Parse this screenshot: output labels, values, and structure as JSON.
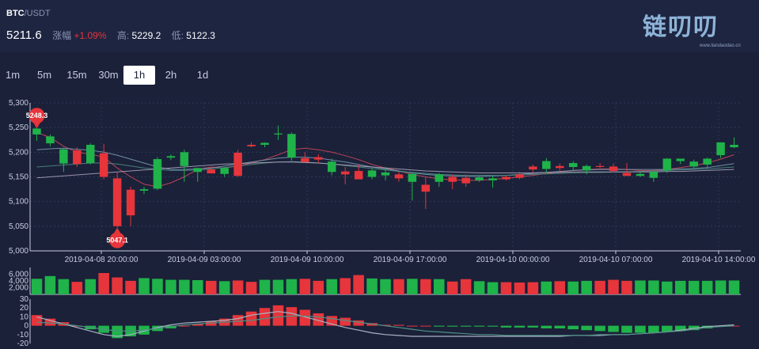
{
  "header": {
    "pair_base": "BTC",
    "pair_quote": "/USDT",
    "last_price": "5211.6",
    "change_label": "涨幅",
    "change_value": "+1.09%",
    "high_label": "高:",
    "high_value": "5229.2",
    "low_label": "低:",
    "low_value": "5122.3"
  },
  "logo": {
    "text": "链叨叨",
    "url": "www.liandaodao.cn"
  },
  "timeframes": [
    {
      "label": "1m"
    },
    {
      "label": "5m"
    },
    {
      "label": "15m"
    },
    {
      "label": "30m"
    },
    {
      "label": "1h"
    },
    {
      "label": "2h"
    },
    {
      "label": "1d"
    }
  ],
  "active_timeframe": "1h",
  "colors": {
    "up": "#1fb34a",
    "down": "#e6353b",
    "grid": "#2f3859",
    "axis": "#c8cde0",
    "background": "#1b2139"
  },
  "chart_data": [
    {
      "type": "candlestick",
      "y_ticks": [
        "5,000",
        "5,050",
        "5,100",
        "5,150",
        "5,200",
        "5,250",
        "5,300"
      ],
      "ylim": [
        5000,
        5300
      ],
      "x_ticks": [
        "2019-04-08 20:00:00",
        "2019-04-09 03:00:00",
        "2019-04-09 10:00:00",
        "2019-04-09 17:00:00",
        "2019-04-10 00:00:00",
        "2019-04-10 07:00:00",
        "2019-04-10 14:00:00"
      ],
      "max_label": "5248.3",
      "min_label": "5047.1",
      "candles": [
        [
          5236,
          5250,
          5223,
          5248
        ],
        [
          5218,
          5236,
          5212,
          5232
        ],
        [
          5177,
          5208,
          5160,
          5206
        ],
        [
          5204,
          5210,
          5170,
          5176
        ],
        [
          5178,
          5218,
          5175,
          5215
        ],
        [
          5198,
          5217,
          5145,
          5150
        ],
        [
          5147,
          5160,
          5047,
          5050
        ],
        [
          5124,
          5130,
          5050,
          5072
        ],
        [
          5122,
          5130,
          5115,
          5125
        ],
        [
          5126,
          5190,
          5123,
          5186
        ],
        [
          5189,
          5196,
          5184,
          5192
        ],
        [
          5172,
          5205,
          5140,
          5200
        ],
        [
          5160,
          5168,
          5140,
          5168
        ],
        [
          5165,
          5170,
          5158,
          5157
        ],
        [
          5156,
          5170,
          5150,
          5168
        ],
        [
          5199,
          5205,
          5150,
          5152
        ],
        [
          5215,
          5220,
          5210,
          5212
        ],
        [
          5215,
          5220,
          5210,
          5219
        ],
        [
          5236,
          5254,
          5225,
          5238
        ],
        [
          5189,
          5240,
          5183,
          5237
        ],
        [
          5188,
          5200,
          5180,
          5180
        ],
        [
          5190,
          5196,
          5178,
          5185
        ],
        [
          5160,
          5187,
          5153,
          5181
        ],
        [
          5161,
          5170,
          5135,
          5155
        ],
        [
          5162,
          5175,
          5150,
          5145
        ],
        [
          5150,
          5168,
          5145,
          5163
        ],
        [
          5153,
          5170,
          5143,
          5159
        ],
        [
          5155,
          5160,
          5140,
          5147
        ],
        [
          5140,
          5158,
          5102,
          5156
        ],
        [
          5134,
          5150,
          5085,
          5120
        ],
        [
          5140,
          5158,
          5130,
          5155
        ],
        [
          5150,
          5155,
          5125,
          5140
        ],
        [
          5148,
          5155,
          5130,
          5137
        ],
        [
          5143,
          5150,
          5140,
          5149
        ],
        [
          5143,
          5152,
          5128,
          5147
        ],
        [
          5150,
          5153,
          5143,
          5145
        ],
        [
          5155,
          5160,
          5145,
          5148
        ],
        [
          5171,
          5175,
          5158,
          5165
        ],
        [
          5166,
          5188,
          5158,
          5182
        ],
        [
          5172,
          5177,
          5160,
          5168
        ],
        [
          5170,
          5182,
          5162,
          5178
        ],
        [
          5163,
          5175,
          5155,
          5172
        ],
        [
          5172,
          5178,
          5168,
          5170
        ],
        [
          5171,
          5177,
          5159,
          5162
        ],
        [
          5158,
          5178,
          5152,
          5152
        ],
        [
          5152,
          5160,
          5150,
          5156
        ],
        [
          5148,
          5163,
          5140,
          5160
        ],
        [
          5163,
          5188,
          5158,
          5187
        ],
        [
          5182,
          5186,
          5176,
          5187
        ],
        [
          5171,
          5185,
          5167,
          5181
        ],
        [
          5175,
          5189,
          5167,
          5187
        ],
        [
          5194,
          5220,
          5188,
          5220
        ],
        [
          5210,
          5230,
          5208,
          5215
        ]
      ],
      "ma_lines": [
        {
          "color": "#d64a5a",
          "values": [
            5240,
            5230,
            5212,
            5200,
            5196,
            5190,
            5168,
            5150,
            5135,
            5130,
            5138,
            5150,
            5165,
            5170,
            5168,
            5172,
            5178,
            5185,
            5195,
            5205,
            5208,
            5205,
            5200,
            5193,
            5185,
            5175,
            5168,
            5162,
            5155,
            5150,
            5146,
            5144,
            5143,
            5143,
            5145,
            5147,
            5150,
            5153,
            5157,
            5160,
            5163,
            5165,
            5166,
            5166,
            5165,
            5163,
            5163,
            5165,
            5169,
            5173,
            5178,
            5186,
            5195
          ]
        },
        {
          "color": "#7fa0b8",
          "values": [
            5205,
            5207,
            5208,
            5206,
            5204,
            5200,
            5194,
            5186,
            5178,
            5170,
            5165,
            5165,
            5166,
            5168,
            5172,
            5176,
            5180,
            5184,
            5188,
            5190,
            5190,
            5188,
            5184,
            5180,
            5175,
            5170,
            5166,
            5162,
            5158,
            5155,
            5153,
            5152,
            5151,
            5151,
            5152,
            5153,
            5155,
            5157,
            5159,
            5161,
            5163,
            5164,
            5165,
            5165,
            5165,
            5165,
            5165,
            5165,
            5166,
            5167,
            5169,
            5173,
            5177
          ]
        },
        {
          "color": "#4f8f86",
          "values": [
            5170,
            5172,
            5174,
            5176,
            5178,
            5178,
            5176,
            5172,
            5168,
            5165,
            5163,
            5163,
            5164,
            5166,
            5169,
            5172,
            5175,
            5178,
            5180,
            5181,
            5180,
            5178,
            5176,
            5173,
            5170,
            5167,
            5164,
            5161,
            5159,
            5157,
            5155,
            5154,
            5153,
            5153,
            5153,
            5153,
            5154,
            5155,
            5156,
            5157,
            5158,
            5159,
            5159,
            5160,
            5160,
            5161,
            5162,
            5163,
            5164,
            5165,
            5166,
            5168,
            5170
          ]
        },
        {
          "color": "#b0a8c0",
          "values": [
            5148,
            5150,
            5152,
            5154,
            5156,
            5158,
            5160,
            5162,
            5164,
            5166,
            5168,
            5170,
            5172,
            5174,
            5176,
            5177,
            5178,
            5179,
            5180,
            5180,
            5179,
            5178,
            5176,
            5174,
            5172,
            5170,
            5168,
            5166,
            5164,
            5162,
            5161,
            5160,
            5159,
            5158,
            5158,
            5158,
            5158,
            5158,
            5159,
            5159,
            5160,
            5160,
            5160,
            5160,
            5160,
            5160,
            5160,
            5161,
            5161,
            5162,
            5163,
            5164,
            5165
          ]
        }
      ]
    },
    {
      "type": "bar",
      "name": "volume",
      "y_ticks": [
        "2,000",
        "4,000",
        "6,000"
      ],
      "values": [
        4600,
        5400,
        4500,
        3700,
        4500,
        6300,
        5000,
        4000,
        4800,
        4600,
        4300,
        4300,
        4200,
        4000,
        3900,
        4100,
        3700,
        4300,
        4300,
        4500,
        4600,
        4000,
        4500,
        4800,
        5700,
        4700,
        4500,
        4500,
        4600,
        4500,
        4500,
        3800,
        4500,
        3900,
        3600,
        3600,
        3500,
        3600,
        3800,
        3900,
        3800,
        4000,
        4000,
        4300,
        4000,
        4100,
        4100,
        3800,
        4000,
        4000,
        4000,
        4100,
        4100
      ]
    },
    {
      "type": "bar",
      "name": "macd",
      "y_ticks": [
        "30",
        "20",
        "10",
        "0",
        "-10",
        "-20"
      ],
      "ylim": [
        -20,
        30
      ],
      "histogram": [
        12,
        8,
        4,
        0,
        -4,
        -8,
        -14,
        -12,
        -10,
        -6,
        -3,
        0,
        2,
        5,
        8,
        12,
        16,
        20,
        23,
        21,
        18,
        14,
        11,
        9,
        6,
        3,
        1,
        1,
        0,
        0,
        -1,
        -1,
        -1,
        -1,
        -1,
        -2,
        -2,
        -2,
        -3,
        -3,
        -4,
        -5,
        -6,
        -7,
        -8,
        -8,
        -8,
        -7,
        -6,
        -5,
        -3,
        -1,
        0
      ],
      "dif": [
        10,
        6,
        2,
        -2,
        -6,
        -10,
        -12,
        -10,
        -6,
        -2,
        1,
        3,
        4,
        5,
        6,
        8,
        12,
        14,
        16,
        14,
        10,
        6,
        2,
        -2,
        -5,
        -8,
        -10,
        -11,
        -12,
        -12,
        -12,
        -12,
        -12,
        -12,
        -12,
        -12,
        -12,
        -12,
        -12,
        -12,
        -11,
        -11,
        -11,
        -10,
        -10,
        -9,
        -8,
        -7,
        -5,
        -3,
        -1,
        0,
        1
      ],
      "dea": [
        4,
        3,
        2,
        0,
        -2,
        -4,
        -6,
        -6,
        -5,
        -3,
        -1,
        1,
        2,
        3,
        4,
        5,
        6,
        8,
        10,
        11,
        11,
        10,
        8,
        6,
        4,
        2,
        0,
        -2,
        -4,
        -6,
        -7,
        -8,
        -9,
        -10,
        -10,
        -11,
        -11,
        -11,
        -11,
        -11,
        -11,
        -11,
        -10,
        -10,
        -10,
        -9,
        -8,
        -7,
        -6,
        -4,
        -2,
        -1,
        0
      ]
    }
  ]
}
